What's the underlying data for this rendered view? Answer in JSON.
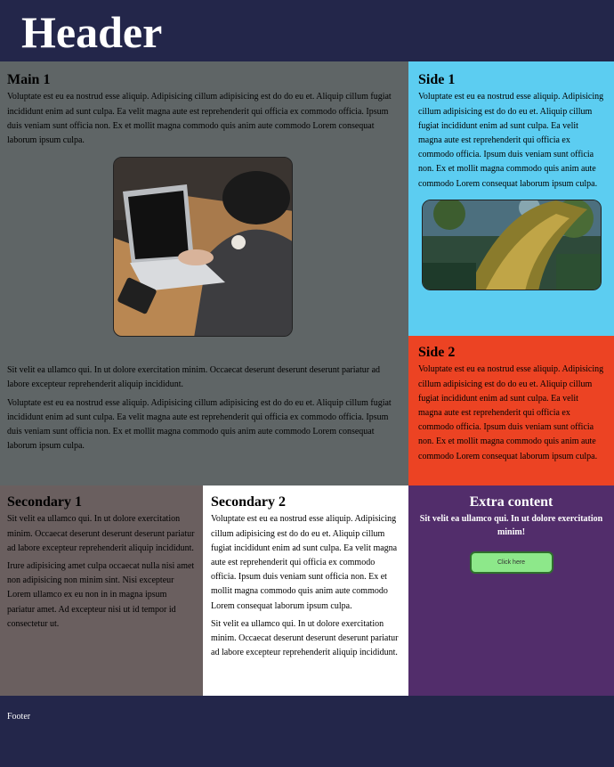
{
  "header": {
    "title": "Header"
  },
  "main": {
    "title": "Main 1",
    "para1": "Voluptate est eu ea nostrud esse aliquip. Adipisicing cillum adipisicing est do do eu et. Aliquip cillum fugiat incididunt enim ad sunt culpa. Ea velit magna aute est reprehenderit qui officia ex commodo officia. Ipsum duis veniam sunt officia non. Ex et mollit magna commodo quis anim aute commodo Lorem consequat laborum ipsum culpa.",
    "para2": "Sit velit ea ullamco qui. In ut dolore exercitation minim. Occaecat deserunt deserunt deserunt pariatur ad labore excepteur reprehenderit aliquip incididunt.",
    "para3": "Voluptate est eu ea nostrud esse aliquip. Adipisicing cillum adipisicing est do do eu et. Aliquip cillum fugiat incididunt enim ad sunt culpa. Ea velit magna aute est reprehenderit qui officia ex commodo officia. Ipsum duis veniam sunt officia non. Ex et mollit magna commodo quis anim aute commodo Lorem consequat laborum ipsum culpa."
  },
  "side1": {
    "title": "Side 1",
    "para": "Voluptate est eu ea nostrud esse aliquip. Adipisicing cillum adipisicing est do do eu et. Aliquip cillum fugiat incididunt enim ad sunt culpa. Ea velit magna aute est reprehenderit qui officia ex commodo officia. Ipsum duis veniam sunt officia non. Ex et mollit magna commodo quis anim aute commodo Lorem consequat laborum ipsum culpa."
  },
  "side2": {
    "title": "Side 2",
    "para": "Voluptate est eu ea nostrud esse aliquip. Adipisicing cillum adipisicing est do do eu et. Aliquip cillum fugiat incididunt enim ad sunt culpa. Ea velit magna aute est reprehenderit qui officia ex commodo officia. Ipsum duis veniam sunt officia non. Ex et mollit magna commodo quis anim aute commodo Lorem consequat laborum ipsum culpa."
  },
  "secondary1": {
    "title": "Secondary 1",
    "para1": "Sit velit ea ullamco qui. In ut dolore exercitation minim. Occaecat deserunt deserunt deserunt pariatur ad labore excepteur reprehenderit aliquip incididunt.",
    "para2": "Irure adipisicing amet culpa occaecat nulla nisi amet non adipisicing non minim sint. Nisi excepteur Lorem ullamco ex eu non in in magna ipsum pariatur amet. Ad excepteur nisi ut id tempor id consectetur ut."
  },
  "secondary2": {
    "title": "Secondary 2",
    "para1": "Voluptate est eu ea nostrud esse aliquip. Adipisicing cillum adipisicing est do do eu et. Aliquip cillum fugiat incididunt enim ad sunt culpa. Ea velit magna aute est reprehenderit qui officia ex commodo officia. Ipsum duis veniam sunt officia non. Ex et mollit magna commodo quis anim aute commodo Lorem consequat laborum ipsum culpa.",
    "para2": "Sit velit ea ullamco qui. In ut dolore exercitation minim. Occaecat deserunt deserunt deserunt pariatur ad labore excepteur reprehenderit aliquip incididunt."
  },
  "extra": {
    "title": "Extra content",
    "text": "Sit velit ea ullamco qui. In ut dolore exercitation minim!",
    "button_label": "Click here"
  },
  "footer": {
    "text": "Footer"
  },
  "colors": {
    "header_bg": "#23264a",
    "main_bg": "#5f6566",
    "side1_bg": "#5ccdf1",
    "side2_bg": "#ec4323",
    "secondary1_bg": "#6a5f5f",
    "secondary2_bg": "#ffffff",
    "extra_bg": "#522d6b",
    "button_bg": "#8de88a"
  }
}
